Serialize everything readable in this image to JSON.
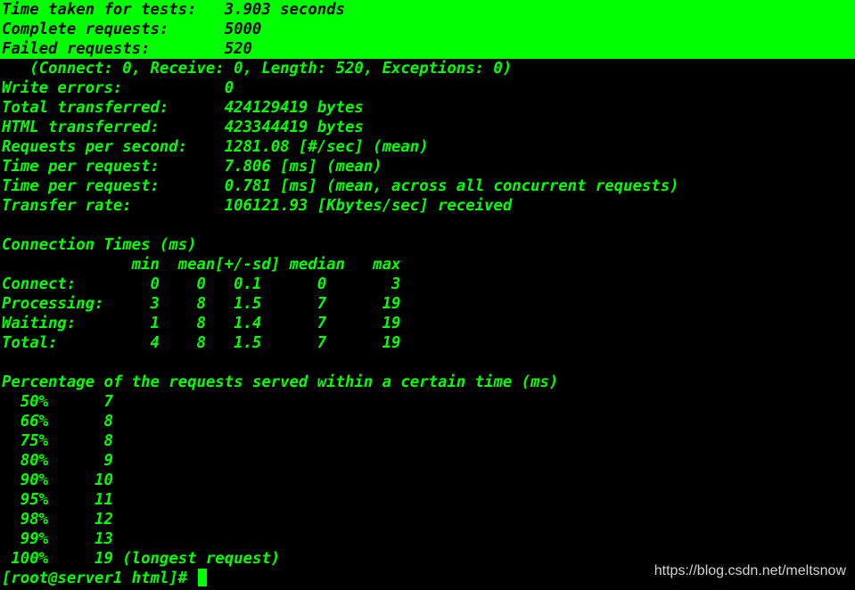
{
  "theme": {
    "background": "#000000",
    "foreground": "#00ff00",
    "highlight_bg": "#00ff00",
    "highlight_fg": "#000000",
    "watermark_color": "#d4d4d4"
  },
  "highlighted_lines": [
    "Time taken for tests:   3.903 seconds",
    "Complete requests:      5000",
    "Failed requests:        520"
  ],
  "lines": [
    "   (Connect: 0, Receive: 0, Length: 520, Exceptions: 0)",
    "Write errors:           0",
    "Total transferred:      424129419 bytes",
    "HTML transferred:       423344419 bytes",
    "Requests per second:    1281.08 [#/sec] (mean)",
    "Time per request:       7.806 [ms] (mean)",
    "Time per request:       0.781 [ms] (mean, across all concurrent requests)",
    "Transfer rate:          106121.93 [Kbytes/sec] received",
    "",
    "Connection Times (ms)",
    "              min  mean[+/-sd] median   max",
    "Connect:        0    0   0.1      0       3",
    "Processing:     3    8   1.5      7      19",
    "Waiting:        1    8   1.4      7      19",
    "Total:          4    8   1.5      7      19",
    "",
    "Percentage of the requests served within a certain time (ms)",
    "  50%      7",
    "  66%      8",
    "  75%      8",
    "  80%      9",
    "  90%     10",
    "  95%     11",
    "  98%     12",
    "  99%     13",
    " 100%     19 (longest request)"
  ],
  "prompt": "[root@server1 html]# ",
  "watermark": "https://blog.csdn.net/meltsnow"
}
